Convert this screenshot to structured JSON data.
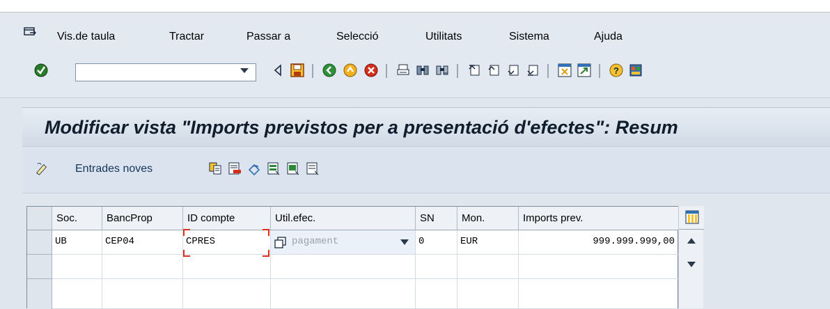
{
  "menu": {
    "items": [
      "Vis.de taula",
      "Tractar",
      "Passar a",
      "Selecció",
      "Utilitats",
      "Sistema",
      "Ajuda"
    ]
  },
  "toolbar": {
    "command_value": "",
    "icons": [
      "enter-check-icon",
      "back-triangle-icon",
      "save-icon",
      "back-icon",
      "exit-icon",
      "cancel-icon",
      "print-icon",
      "find-icon",
      "find-next-icon",
      "first-page-icon",
      "previous-page-icon",
      "next-page-icon",
      "last-page-icon",
      "create-session-icon",
      "shortcut-icon",
      "help-icon",
      "layout-icon"
    ]
  },
  "title": "Modificar vista \"Imports previstos per a presentació d'efectes\": Resum",
  "app_toolbar": {
    "new_entries_label": "Entrades noves"
  },
  "table": {
    "columns": [
      "Soc.",
      "BancProp",
      "ID compte",
      "Util.efec.",
      "SN",
      "Mon.",
      "Imports prev."
    ],
    "rows": [
      {
        "soc": "UB",
        "bancprop": "CEP04",
        "id_compte": "CPRES",
        "util_efec": "pagament",
        "sn": "0",
        "mon": "EUR",
        "imports_prev": "999.999.999,00"
      }
    ]
  },
  "colors": {
    "background": "#dfe6ee",
    "title_text": "#0f1d2c",
    "focus_marker": "#e0301e",
    "accent_green": "#2e8b2e"
  }
}
